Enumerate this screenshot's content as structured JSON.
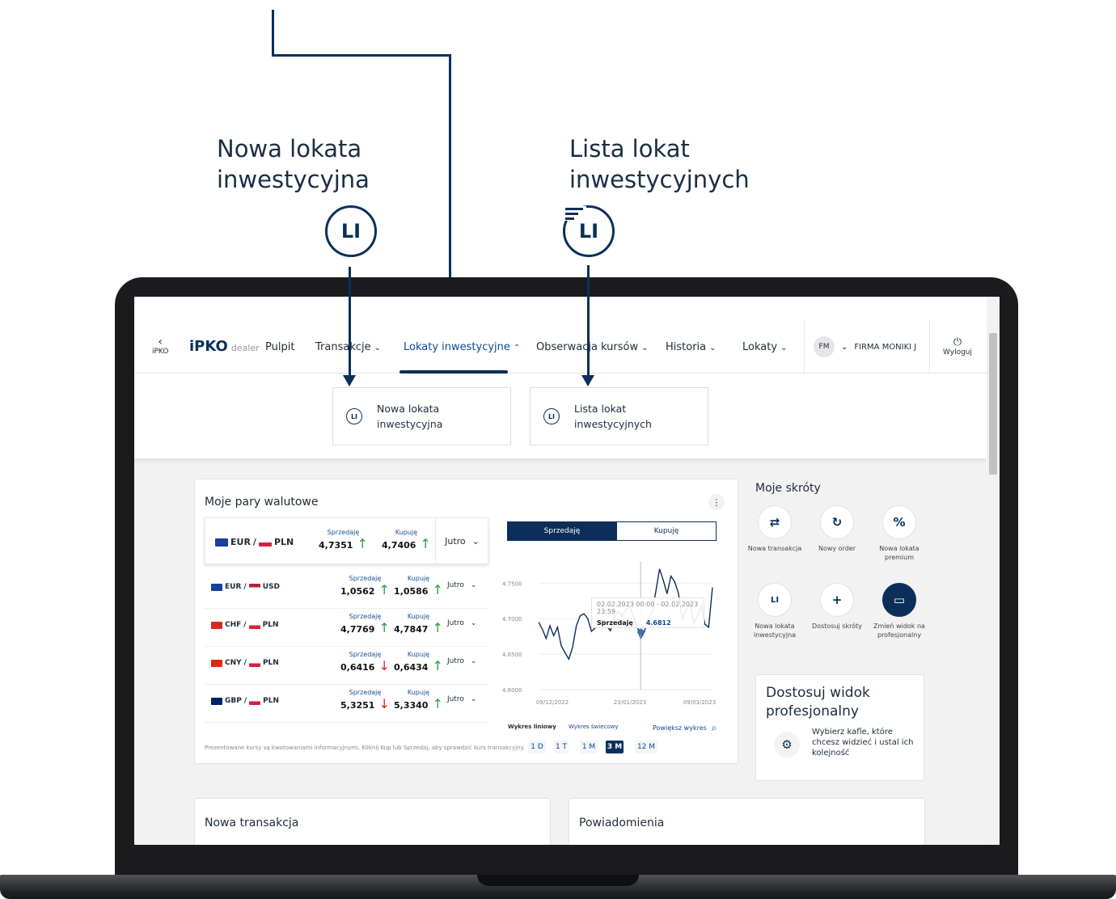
{
  "callouts": {
    "left_line1": "Nowa lokata",
    "left_line2": "inwestycyjna",
    "right_line1": "Lista lokat",
    "right_line2": "inwestycyjnych",
    "icon_label": "LI"
  },
  "app": {
    "back_label": "iPKO",
    "brand_main": "iPKO",
    "brand_sub": "dealer"
  },
  "nav": {
    "items": [
      "Pulpit",
      "Transakcje",
      "Lokaty inwestycyjne",
      "Obserwacja kursów",
      "Historia",
      "Lokaty"
    ],
    "active": "Lokaty inwestycyjne",
    "user_initials": "FM",
    "company": "FIRMA MONIKI J",
    "logout": "Wyloguj"
  },
  "dropdown": {
    "item1_line1": "Nowa lokata",
    "item1_line2": "inwestycyjna",
    "item2_line1": "Lista lokat",
    "item2_line2": "inwestycyjnych"
  },
  "currency_widget": {
    "title": "Moje pary walutowe",
    "col_sell": "Sprzedaję",
    "col_buy": "Kupuję",
    "date_label": "Jutro",
    "pairs": [
      {
        "base": "EUR",
        "quote": "PLN",
        "sell": "4,7351",
        "buy": "4,7406",
        "sell_dir": "↑",
        "buy_dir": "↑"
      },
      {
        "base": "EUR",
        "quote": "USD",
        "sell": "1,0562",
        "buy": "1,0586",
        "sell_dir": "↑",
        "buy_dir": "↑"
      },
      {
        "base": "CHF",
        "quote": "PLN",
        "sell": "4,7769",
        "buy": "4,7847",
        "sell_dir": "↑",
        "buy_dir": "↑"
      },
      {
        "base": "CNY",
        "quote": "PLN",
        "sell": "0,6416",
        "buy": "0,6434",
        "sell_dir": "↓",
        "buy_dir": "↑"
      },
      {
        "base": "GBP",
        "quote": "PLN",
        "sell": "5,3251",
        "buy": "5,3340",
        "sell_dir": "↓",
        "buy_dir": "↑"
      }
    ],
    "disclaimer": "Prezentowane kursy są kwotowaniami informacyjnymi. Kliknij Kup lub Sprzedaj, aby sprawdzić kurs transakcyjny."
  },
  "chart_panel": {
    "tab_sell": "Sprzedaję",
    "tab_buy": "Kupuję",
    "tooltip_range": "02.02.2023 00:00 - 02.02.2023 23:59",
    "tooltip_label": "Sprzedaję",
    "tooltip_value": "4.6812",
    "chart_type_line": "Wykres liniowy",
    "chart_type_candle": "Wykres świecowy",
    "zoom": "Powiększ wykres",
    "ranges": [
      "1 D",
      "1 T",
      "1 M",
      "3 M",
      "12 M"
    ],
    "active_range": "3 M"
  },
  "chart_data": {
    "type": "line",
    "x_ticks": [
      "09/12/2022",
      "23/01/2023",
      "09/03/2023"
    ],
    "y_ticks": [
      "4.7500",
      "4.7000",
      "4.6500",
      "4.6000"
    ],
    "ylim": [
      4.6,
      4.78
    ],
    "series": [
      {
        "values": [
          4.695,
          4.685,
          4.672,
          4.69,
          4.676,
          4.688,
          4.662,
          4.652,
          4.643,
          4.66,
          4.69,
          4.704,
          4.707,
          4.7,
          4.682,
          4.687,
          4.694,
          4.698,
          4.69,
          4.683,
          4.701,
          4.71,
          4.703,
          4.712,
          4.718,
          4.705,
          4.691,
          4.672,
          4.682,
          4.701,
          4.708,
          4.738,
          4.77,
          4.754,
          4.735,
          4.76,
          4.752,
          4.736,
          4.7,
          4.712,
          4.721,
          4.694,
          4.703,
          4.718,
          4.692,
          4.688,
          4.744
        ]
      }
    ]
  },
  "shortcuts": {
    "title": "Moje skróty",
    "items": [
      "Nowa transakcja",
      "Nowy order",
      "Nowa lokata premium",
      "Nowa lokata inwestycyjna",
      "Dostosuj skróty",
      "Zmień widok na profesjonalny"
    ],
    "icons": [
      "exchange-icon",
      "order-icon",
      "percent-star-icon",
      "li-icon",
      "plus-icon",
      "monitor-icon"
    ]
  },
  "pro_view": {
    "title_line1": "Dostosuj widok",
    "title_line2": "profesjonalny",
    "body": "Wybierz kafle, które chcesz widzieć i ustal ich kolejność"
  },
  "bottom_cards": {
    "left_title": "Nowa transakcja",
    "right_title": "Powiadomienia"
  }
}
